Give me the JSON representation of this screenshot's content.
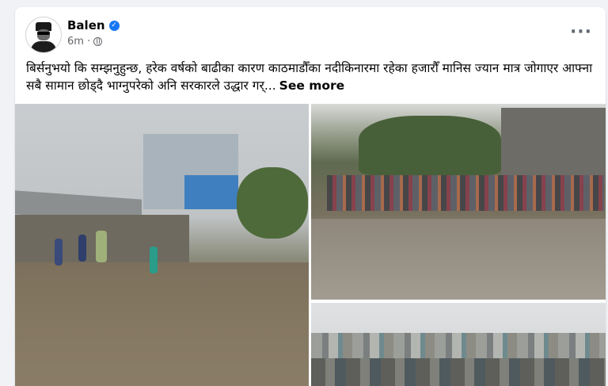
{
  "post": {
    "author": "Balen",
    "verified_mark": "✓",
    "time": "6m",
    "separator": "·",
    "audience_icon": "globe-icon",
    "more_icon": "···",
    "text": "बिर्सनुभयो कि सम्झनुहुन्छ, हरेक वर्षको बाढीका कारण काठमाडौँका नदीकिनारमा रहेका हजारौँ मानिस ज्यान मात्र जोगाएर आफ्ना सबै सामान छोड्दै भाग्नुपरेको अनि सरकारले उद्धार गर्...",
    "see_more": "See more"
  },
  "photos": [
    {
      "description_key": "photo-1"
    },
    {
      "description_key": "photo-2"
    },
    {
      "description_key": "photo-3"
    }
  ],
  "colors": {
    "verified": "#1877f2",
    "text": "#050505",
    "meta": "#65676b"
  }
}
